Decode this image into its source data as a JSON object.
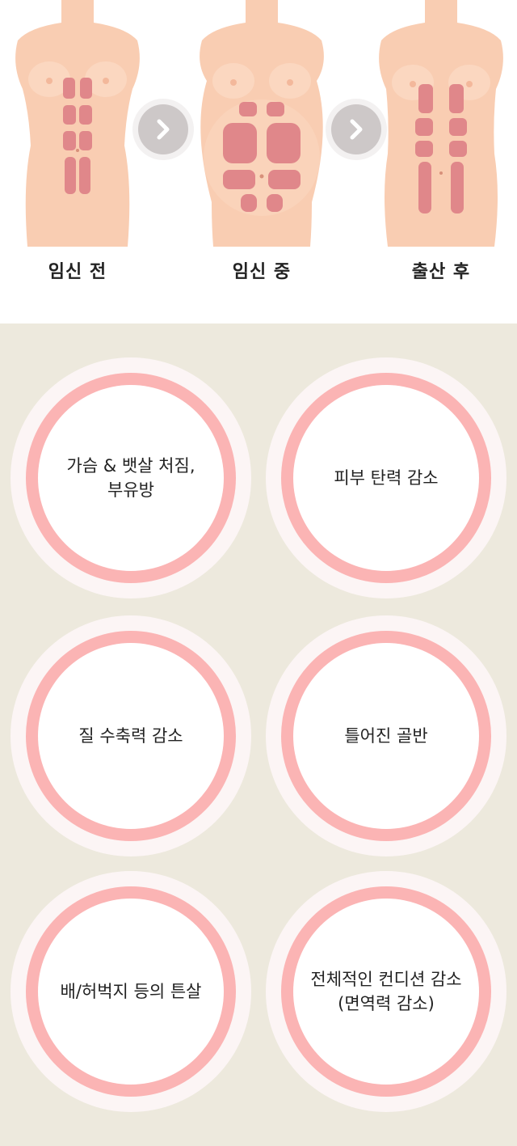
{
  "stages": [
    {
      "label": "임신 전"
    },
    {
      "label": "임신 중"
    },
    {
      "label": "출산 후"
    }
  ],
  "arrows": [
    {
      "icon": "chevron-right-icon"
    },
    {
      "icon": "chevron-right-icon"
    }
  ],
  "colors": {
    "skin": "#f9cdb2",
    "muscle": "#e0878a",
    "ring": "#fbb4b4",
    "beige_bg": "#ede9dd",
    "arrow": "#cdc8c8"
  },
  "symptoms": [
    {
      "lines": [
        "가슴 & 뱃살 처짐,",
        "부유방"
      ]
    },
    {
      "lines": [
        "피부 탄력 감소"
      ]
    },
    {
      "lines": [
        "질 수축력 감소"
      ]
    },
    {
      "lines": [
        "틀어진 골반"
      ]
    },
    {
      "lines": [
        "배/허벅지 등의 튼살"
      ]
    },
    {
      "lines": [
        "전체적인 컨디션 감소",
        "(면역력 감소)"
      ]
    }
  ]
}
